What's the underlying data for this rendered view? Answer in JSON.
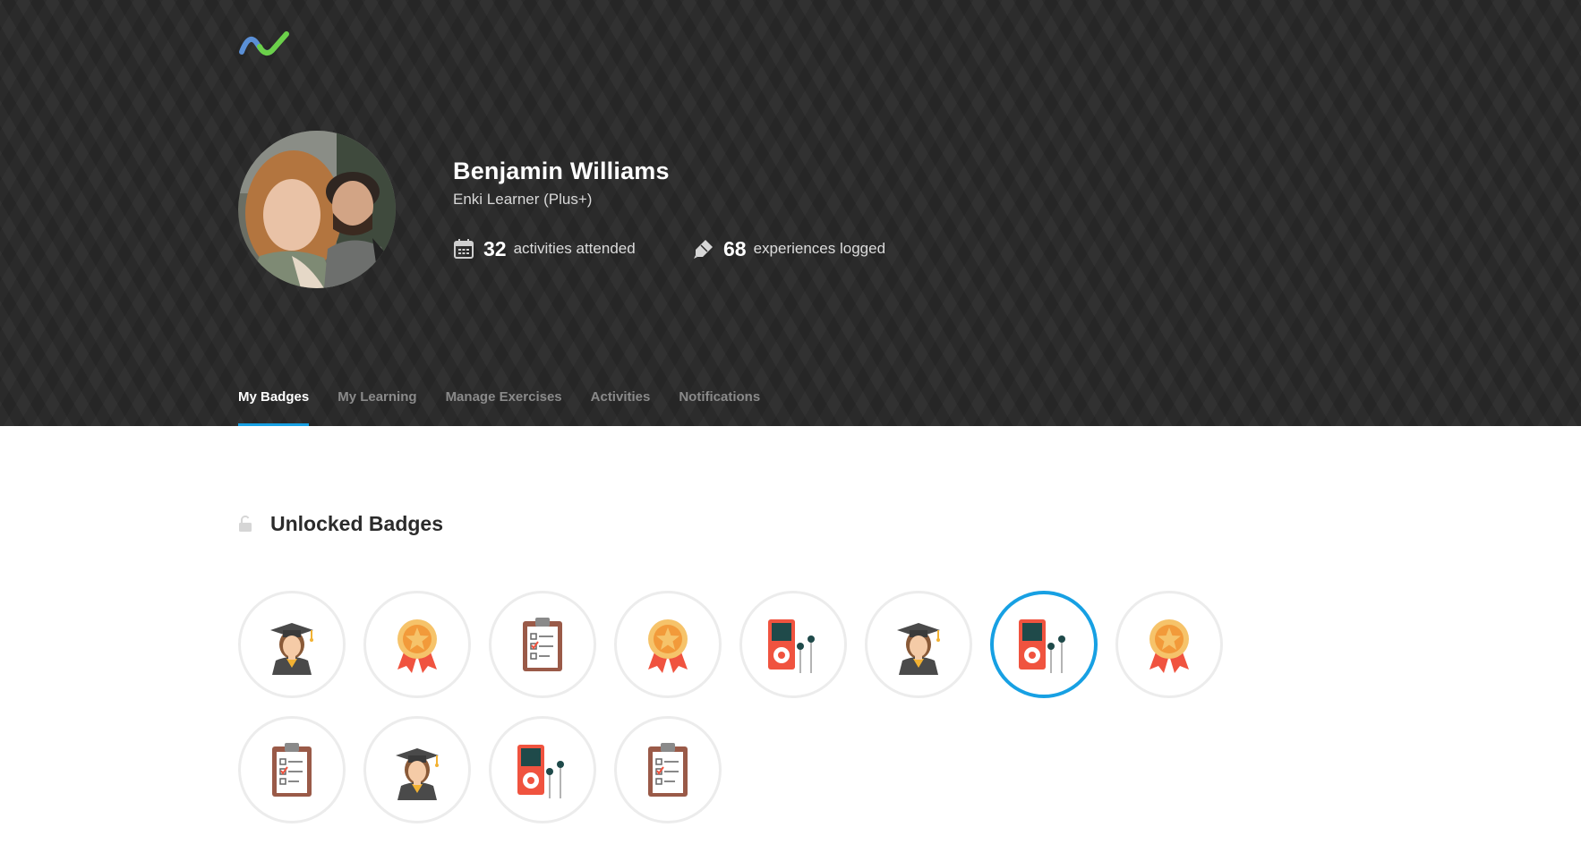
{
  "profile": {
    "name": "Benjamin Williams",
    "role": "Enki Learner (Plus+)",
    "activities_count": "32",
    "activities_label": "activities attended",
    "experiences_count": "68",
    "experiences_label": "experiences logged"
  },
  "tabs": [
    {
      "label": "My Badges",
      "active": true
    },
    {
      "label": "My Learning",
      "active": false
    },
    {
      "label": "Manage Exercises",
      "active": false
    },
    {
      "label": "Activities",
      "active": false
    },
    {
      "label": "Notifications",
      "active": false
    }
  ],
  "badges_section": {
    "title": "Unlocked Badges",
    "badges": [
      {
        "icon": "graduate-icon",
        "selected": false
      },
      {
        "icon": "medal-icon",
        "selected": false
      },
      {
        "icon": "clipboard-icon",
        "selected": false
      },
      {
        "icon": "medal-icon",
        "selected": false
      },
      {
        "icon": "music-player-icon",
        "selected": false
      },
      {
        "icon": "graduate-icon",
        "selected": false
      },
      {
        "icon": "music-player-icon",
        "selected": true
      },
      {
        "icon": "medal-icon",
        "selected": false
      },
      {
        "icon": "clipboard-icon",
        "selected": false
      },
      {
        "icon": "graduate-icon",
        "selected": false
      },
      {
        "icon": "music-player-icon",
        "selected": false
      },
      {
        "icon": "clipboard-icon",
        "selected": false
      }
    ]
  },
  "colors": {
    "header_bg": "#2a2a2a",
    "accent": "#17a0e3",
    "badge_border": "#ececec"
  }
}
